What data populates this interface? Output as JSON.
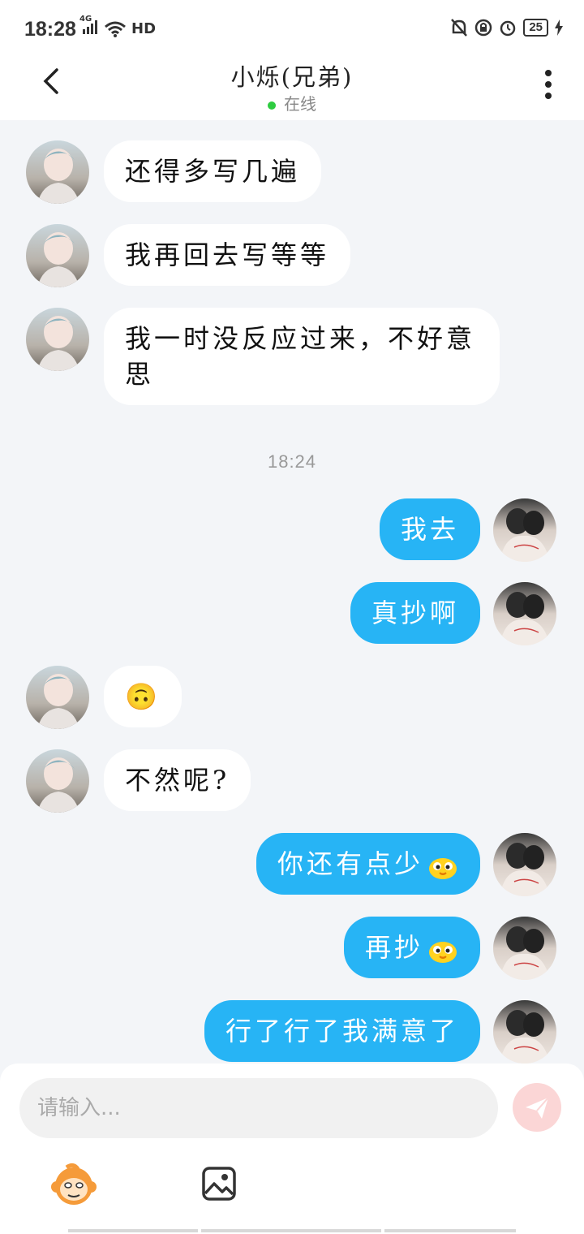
{
  "status_bar": {
    "time": "18:28",
    "network": "4G",
    "hd": "HD",
    "battery": "25"
  },
  "header": {
    "title": "小烁(兄弟)",
    "status": "在线"
  },
  "messages": [
    {
      "side": "in",
      "text": "还得多写几遍"
    },
    {
      "side": "in",
      "text": "我再回去写等等"
    },
    {
      "side": "in",
      "text_line1": "我一时没反应过来，不好意",
      "text_line2": "思"
    },
    {
      "timestamp": "18:24"
    },
    {
      "side": "out",
      "text": "我去"
    },
    {
      "side": "out",
      "text": "真抄啊"
    },
    {
      "side": "in",
      "text": "🙃"
    },
    {
      "side": "in",
      "text": "不然呢?"
    },
    {
      "side": "out",
      "text": "你还有点少",
      "sticker": "yellow-chick-sticker-icon"
    },
    {
      "side": "out",
      "text": "再抄",
      "sticker": "yellow-chick-sticker-icon"
    },
    {
      "side": "out",
      "text": "行了行了我满意了"
    }
  ],
  "composer": {
    "placeholder": "请输入...",
    "send_icon": "paper-plane-icon",
    "tools": [
      "monkey-emoji-icon",
      "image-icon"
    ]
  },
  "colors": {
    "outgoing_bubble": "#27b4f5",
    "incoming_bubble": "#ffffff",
    "chat_background": "#f3f5f8",
    "online_dot": "#2ecc40"
  }
}
